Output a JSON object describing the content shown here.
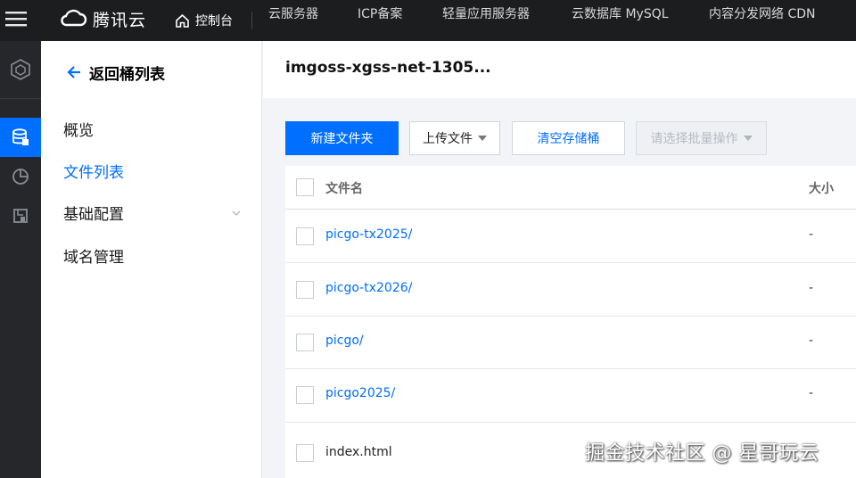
{
  "topbar": {
    "brand": "腾讯云",
    "console": "控制台",
    "nav": [
      "云服务器",
      "ICP备案",
      "轻量应用服务器",
      "云数据库 MySQL",
      "内容分发网络 CDN"
    ]
  },
  "sidebar": {
    "back_label": "返回桶列表",
    "items": [
      {
        "label": "概览"
      },
      {
        "label": "文件列表"
      },
      {
        "label": "基础配置"
      },
      {
        "label": "域名管理"
      }
    ]
  },
  "main": {
    "bucket_title": "imgoss-xgss-net-1305...",
    "toolbar": {
      "new_folder": "新建文件夹",
      "upload": "上传文件",
      "clear_bucket": "清空存储桶",
      "batch": "请选择批量操作"
    },
    "table": {
      "columns": {
        "name": "文件名",
        "size": "大小"
      },
      "rows": [
        {
          "name": "picgo-tx2025/",
          "size": "-"
        },
        {
          "name": "picgo-tx2026/",
          "size": "-"
        },
        {
          "name": "picgo/",
          "size": "-"
        },
        {
          "name": "picgo2025/",
          "size": "-"
        },
        {
          "name": "index.html",
          "size": ""
        }
      ]
    }
  },
  "watermark": "掘金技术社区 @ 星哥玩云",
  "colors": {
    "accent": "#006eff",
    "topbar": "#1c1d1f",
    "iconbar": "#26272b"
  }
}
